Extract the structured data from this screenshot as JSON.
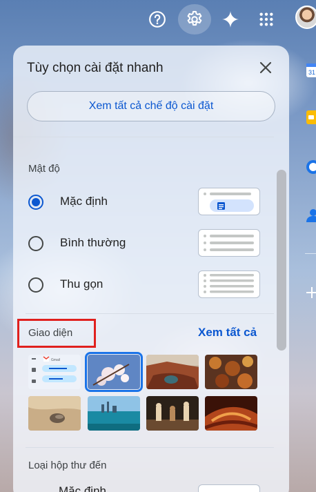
{
  "topbar": {
    "icons": [
      "help-icon",
      "settings-icon",
      "gemini-sparkle-icon",
      "apps-grid-icon"
    ],
    "avatar": "account-avatar"
  },
  "side_panel": {
    "icons": [
      "calendar-icon",
      "keep-icon",
      "tasks-icon",
      "contacts-icon",
      "add-icon"
    ],
    "calendar_day": "31"
  },
  "quick_settings": {
    "title": "Tùy chọn cài đặt nhanh",
    "see_all_settings": "Xem tất cả chế độ cài đặt",
    "density": {
      "label": "Mật độ",
      "options": [
        {
          "label": "Mặc định",
          "checked": true
        },
        {
          "label": "Bình thường",
          "checked": false
        },
        {
          "label": "Thu gọn",
          "checked": false
        }
      ]
    },
    "theme": {
      "label": "Giao diện",
      "see_all": "Xem tất cả",
      "preview_brand": "Gmail",
      "thumbnails": [
        "default",
        "cherry-blossom",
        "canyon-lake",
        "autumn-leaves",
        "beach-rock",
        "lake-city",
        "chess",
        "antelope-canyon"
      ],
      "selected": "cherry-blossom"
    },
    "inbox_type": {
      "label": "Loại hộp thư đến",
      "first_option": "Mặc định"
    }
  },
  "colors": {
    "accent": "#0b57d0",
    "highlight_box": "#e0201d"
  }
}
